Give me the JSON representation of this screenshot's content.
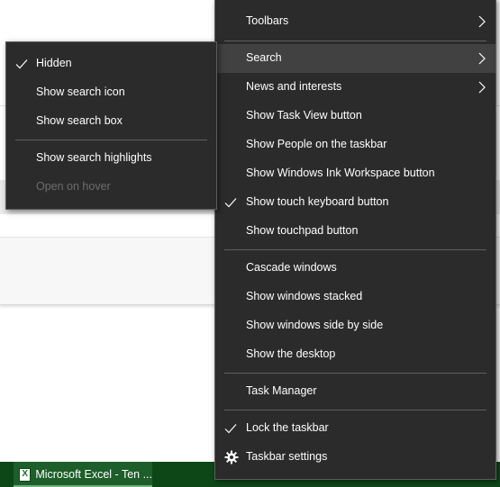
{
  "main_menu": {
    "items": [
      {
        "label": "Toolbars"
      },
      {
        "label": "Search"
      },
      {
        "label": "News and interests"
      },
      {
        "label": "Show Task View button"
      },
      {
        "label": "Show People on the taskbar"
      },
      {
        "label": "Show Windows Ink Workspace button"
      },
      {
        "label": "Show touch keyboard button",
        "checked": true
      },
      {
        "label": "Show touchpad button"
      },
      {
        "label": "Cascade windows"
      },
      {
        "label": "Show windows stacked"
      },
      {
        "label": "Show windows side by side"
      },
      {
        "label": "Show the desktop"
      },
      {
        "label": "Task Manager"
      },
      {
        "label": "Lock the taskbar",
        "checked": true
      },
      {
        "label": "Taskbar settings",
        "icon": "gear-icon"
      }
    ]
  },
  "search_submenu": {
    "items": [
      {
        "label": "Hidden",
        "checked": true
      },
      {
        "label": "Show search icon"
      },
      {
        "label": "Show search box"
      },
      {
        "label": "Show search highlights"
      },
      {
        "label": "Open on hover",
        "disabled": true
      }
    ]
  },
  "taskbar": {
    "app_label": "Microsoft Excel - Ten ...",
    "app_icon": "excel-icon"
  },
  "colors": {
    "menu_background": "#2b2b2b",
    "menu_highlight": "#414141",
    "menu_text": "#ffffff",
    "disabled_text": "#6d6d6d",
    "taskbar": "#0d4718"
  }
}
